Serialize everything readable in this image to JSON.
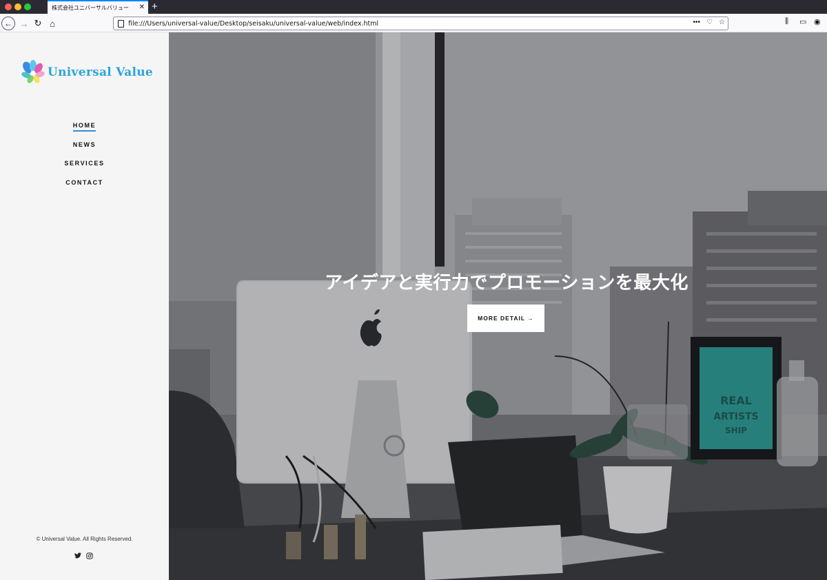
{
  "browser": {
    "tab_title": "株式会社ユニバーサルバリュー",
    "tab_close": "✕",
    "new_tab": "+",
    "url": "file:///Users/universal-value/Desktop/seisaku/universal-value/web/index.html",
    "icons": [
      "back-icon",
      "forward-icon",
      "reload-icon",
      "home-icon",
      "more-icon",
      "pocket-icon",
      "bookmark-star-icon",
      "library-icon",
      "sidebar-icon",
      "account-icon"
    ]
  },
  "sidebar": {
    "logo_text": "Universal Value",
    "menu": [
      {
        "label": "HOME",
        "active": true
      },
      {
        "label": "NEWS",
        "active": false
      },
      {
        "label": "SERVICES",
        "active": false
      },
      {
        "label": "CONTACT",
        "active": false
      }
    ],
    "copyright": "© Universal Value. All Rights Reserved.",
    "social": [
      "twitter-icon",
      "instagram-icon"
    ]
  },
  "hero": {
    "title": "アイデアと実行力でプロモーションを最大化",
    "button_label": "MORE DETAIL →",
    "colors": {
      "overlay": "#5a5b60",
      "accent": "#2e8fd6"
    }
  }
}
